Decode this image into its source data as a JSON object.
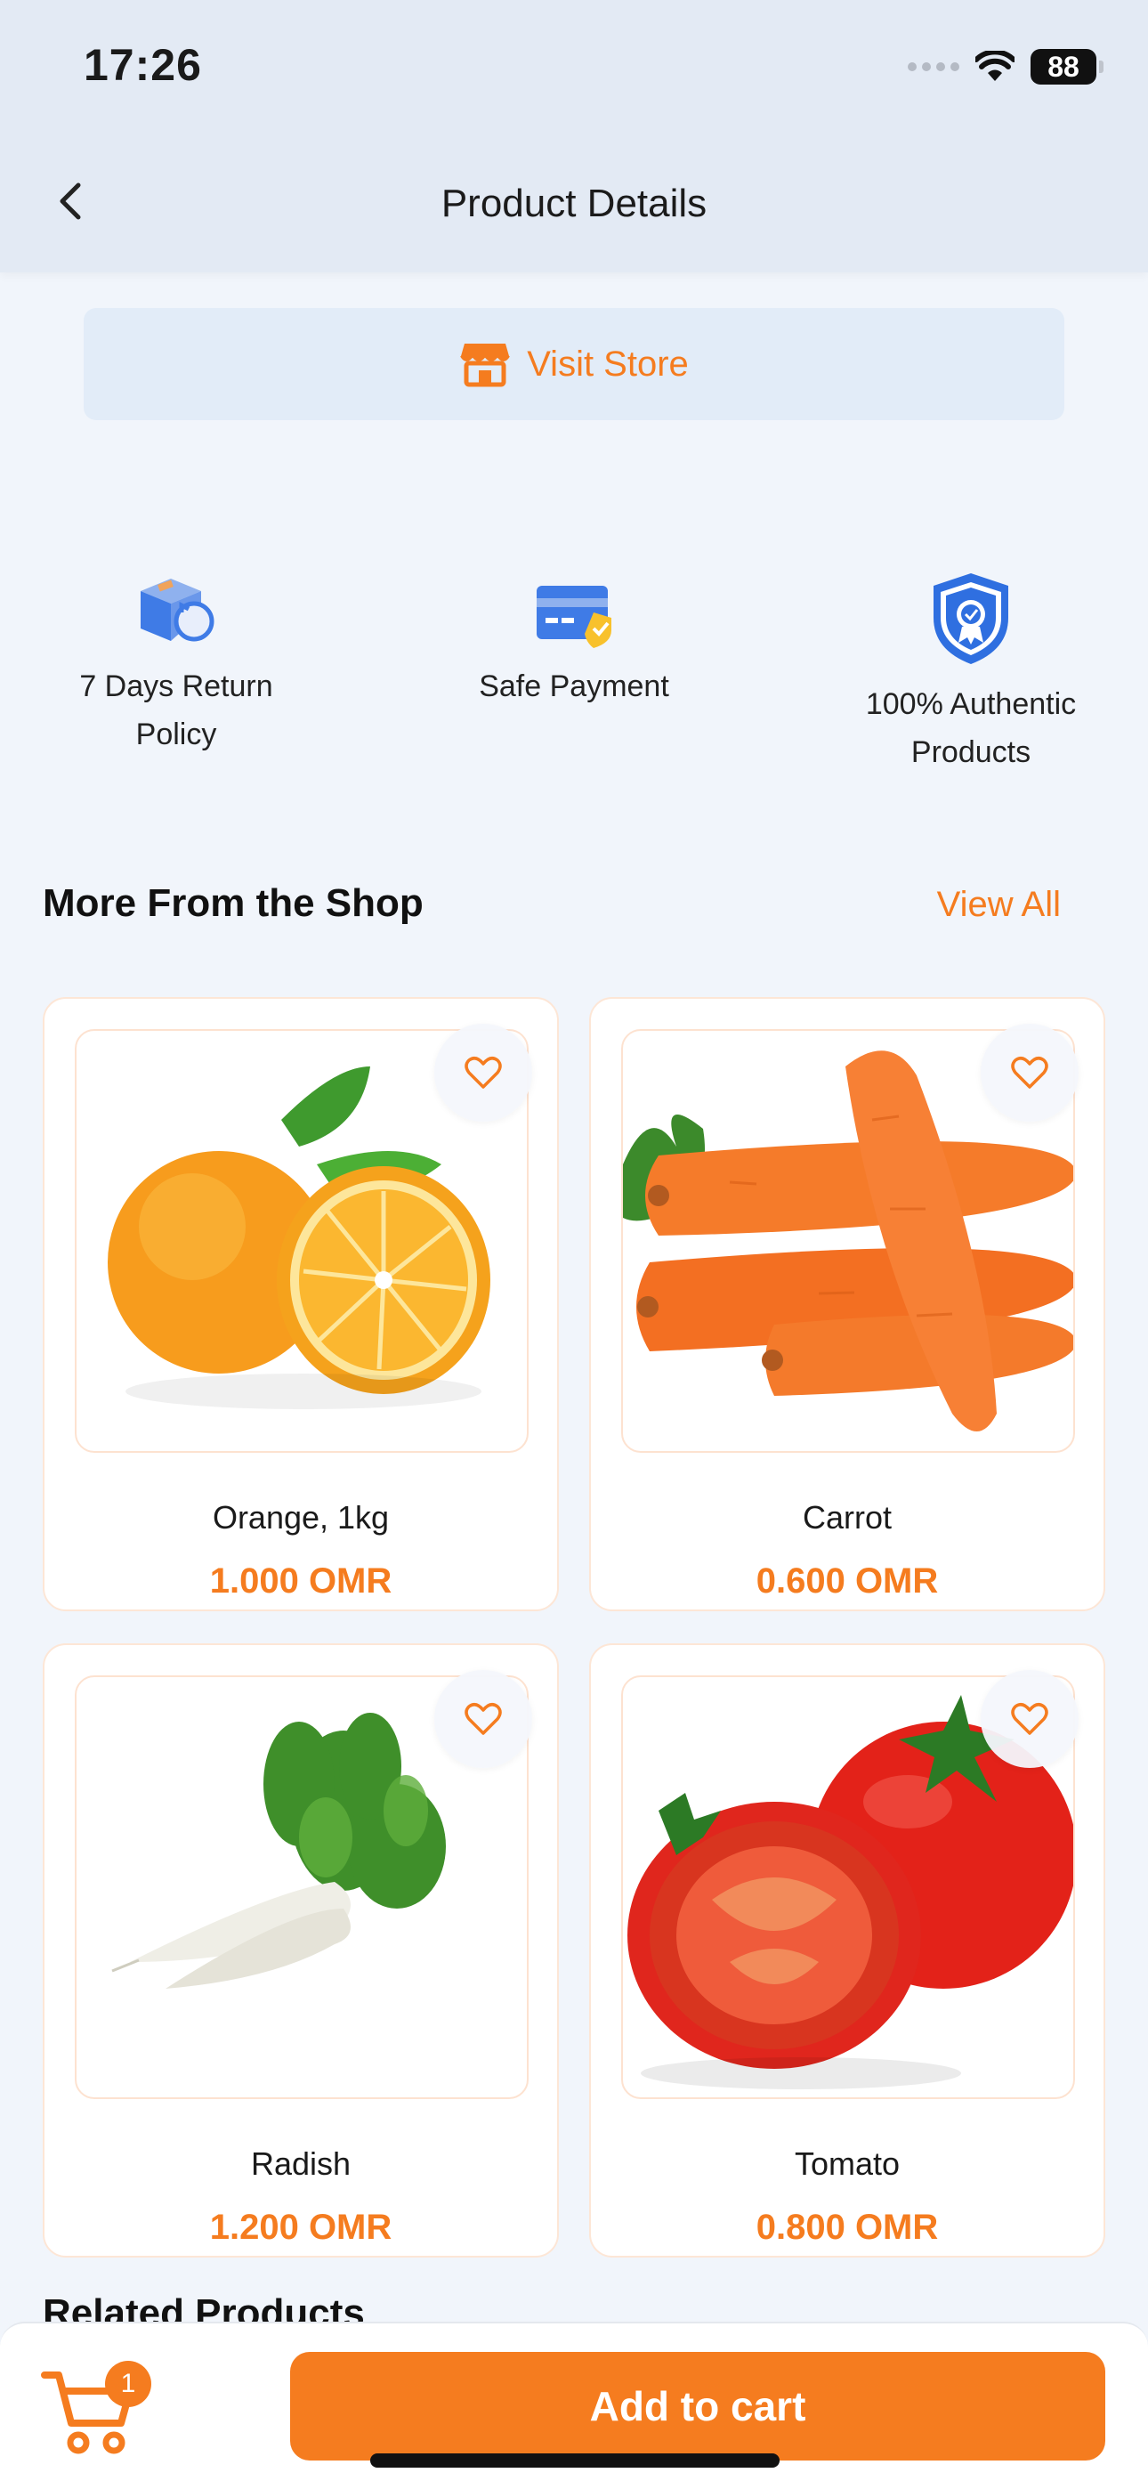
{
  "status_bar": {
    "time": "17:26",
    "battery": "88"
  },
  "header": {
    "title": "Product Details"
  },
  "visit_store": {
    "label": "Visit Store"
  },
  "features": [
    {
      "label": "7 Days Return Policy",
      "icon": "return-box-icon"
    },
    {
      "label": "Safe Payment",
      "icon": "card-shield-icon"
    },
    {
      "label": "100% Authentic Products",
      "icon": "badge-shield-icon"
    }
  ],
  "shop_section": {
    "title": "More From the Shop",
    "view_all": "View All"
  },
  "products": [
    {
      "name": "Orange, 1kg",
      "price": "1.000 OMR",
      "image": "orange-image"
    },
    {
      "name": "Carrot",
      "price": "0.600 OMR",
      "image": "carrot-image"
    },
    {
      "name": "Radish",
      "price": "1.200 OMR",
      "image": "radish-image"
    },
    {
      "name": "Tomato",
      "price": "0.800 OMR",
      "image": "tomato-image"
    }
  ],
  "related_section": {
    "title": "Related Products"
  },
  "bottom_bar": {
    "cart_count": "1",
    "add_to_cart": "Add to cart"
  },
  "colors": {
    "accent": "#f57c1f",
    "header_bg": "#e3eaf4",
    "page_bg": "#f1f5fb",
    "icon_blue": "#2f6fe0"
  }
}
